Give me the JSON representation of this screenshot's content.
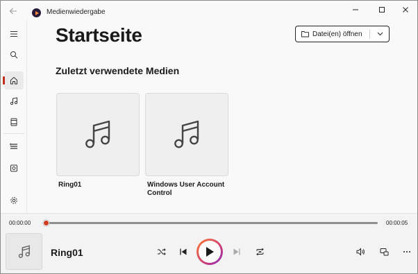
{
  "app": {
    "title": "Medienwiedergabe"
  },
  "window_controls": {
    "minimize": "—",
    "maximize": "☐",
    "close": "✕"
  },
  "nav": {
    "items": [
      {
        "icon": "hamburger-icon"
      },
      {
        "icon": "search-icon"
      },
      {
        "icon": "home-icon",
        "active": true
      },
      {
        "icon": "music-icon"
      },
      {
        "icon": "video-icon"
      },
      {
        "icon": "playlist-icon"
      },
      {
        "icon": "queue-icon"
      },
      {
        "icon": "settings-icon"
      }
    ]
  },
  "main": {
    "page_title": "Startseite",
    "open_button_label": "Datei(en) öffnen",
    "section_title": "Zuletzt verwendete Medien",
    "recent": [
      {
        "name": "Ring01"
      },
      {
        "name": "Windows User Account Control"
      }
    ]
  },
  "player": {
    "elapsed": "00:00:00",
    "total": "00:00:05",
    "progress": 0.0,
    "now_playing": "Ring01"
  },
  "colors": {
    "accent": "#c42b1c",
    "seek_knob": "#d13b1f"
  }
}
